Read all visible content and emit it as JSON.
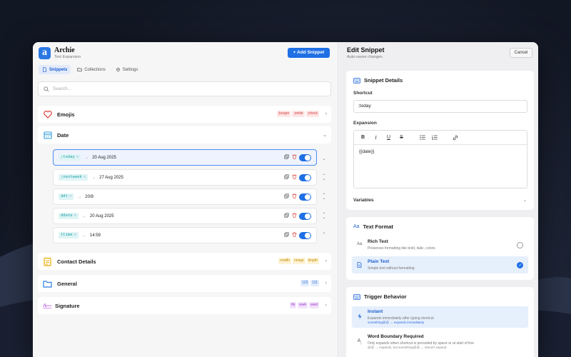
{
  "app": {
    "logo": "a",
    "title": "Archie",
    "subtitle": "Text Expansion",
    "add_button": "+ Add Snippet"
  },
  "tabs": [
    {
      "label": "Snippets",
      "active": true,
      "icon": "document-icon"
    },
    {
      "label": "Collections",
      "active": false,
      "icon": "folder-icon"
    },
    {
      "label": "Settings",
      "active": false,
      "icon": "gear-icon"
    }
  ],
  "search": {
    "placeholder": "Search...",
    "value": ""
  },
  "categories": [
    {
      "name": "Emojis",
      "icon": "heart-icon",
      "tags": [
        ";burger",
        ";smile",
        ";check"
      ],
      "tag_color": "red",
      "expanded": false
    },
    {
      "name": "Date",
      "icon": "calendar-icon",
      "tags": [],
      "expanded": true
    },
    {
      "name": "Contact Details",
      "icon": "notepad-icon",
      "tags": [
        "nnaffn",
        "nnwgr",
        "limpth"
      ],
      "tag_color": "yellow",
      "expanded": false
    },
    {
      "name": "General",
      "icon": "folder-icon",
      "tags": [
        "123",
        "111"
      ],
      "tag_color": "blue",
      "expanded": false
    },
    {
      "name": "Signature",
      "icon": "signature-icon",
      "tags": [
        "ttk",
        "wwk",
        "wwd"
      ],
      "tag_color": "purple",
      "expanded": false
    }
  ],
  "snippets": [
    {
      "shortcut": ";today",
      "expansion": "20 Aug 2025",
      "selected": true,
      "enabled": true
    },
    {
      "shortcut": ";nextweek",
      "expansion": "27 Aug 2025",
      "selected": false,
      "enabled": true
    },
    {
      "shortcut": "ddt",
      "expansion": "20/8",
      "selected": false,
      "enabled": true
    },
    {
      "shortcut": "ddate",
      "expansion": "20 Aug 2025",
      "selected": false,
      "enabled": true
    },
    {
      "shortcut": "ttime",
      "expansion": "14:59",
      "selected": false,
      "enabled": true
    }
  ],
  "arrow_glyph": "→",
  "tag_remove_glyph": "×",
  "edit": {
    "title": "Edit Snippet",
    "subtitle": "Auto-saves changes",
    "cancel": "Cancel",
    "details_heading": "Snippet Details",
    "shortcut_label": "Shortcut",
    "shortcut_value": ";today",
    "expansion_label": "Expansion",
    "toolbar": [
      "B",
      "I",
      "U",
      "S",
      "list-bullet-icon",
      "list-number-icon",
      "link-icon"
    ],
    "expansion_value": "{{date}}",
    "variables_label": "Variables"
  },
  "text_format": {
    "heading": "Text Format",
    "heading_icon": "Aa",
    "options": [
      {
        "title": "Rich Text",
        "desc": "Preserves formatting like bold, italic, colors",
        "icon": "Aa",
        "selected": false
      },
      {
        "title": "Plain Text",
        "desc": "Simple text without formatting",
        "icon": "document-icon",
        "selected": true
      }
    ]
  },
  "trigger": {
    "heading": "Trigger Behavior",
    "options": [
      {
        "title": "Instant",
        "desc": "Expands immediately after typing shortcut",
        "example": "something@@ → expands immediately",
        "icon": "lightning-icon",
        "selected": true
      },
      {
        "title": "Word Boundary Required",
        "desc": "Only expands when shortcut is preceded by space or at start of line",
        "example": "@@ → expands, but something@@ → doesn't expand",
        "icon": "A-boundary-icon",
        "selected": false
      }
    ]
  },
  "colors": {
    "accent": "#1f6fe5",
    "teal": "#1ba2a8",
    "red": "#d63b3b"
  }
}
